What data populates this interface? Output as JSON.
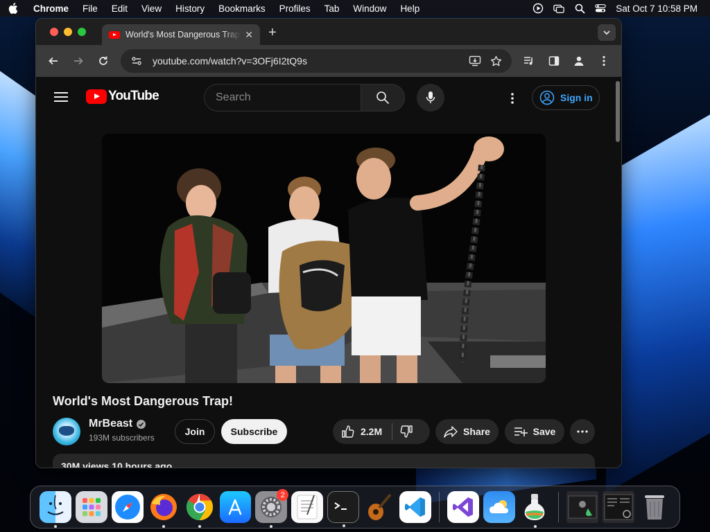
{
  "menubar": {
    "app_name": "Chrome",
    "items": [
      "File",
      "Edit",
      "View",
      "History",
      "Bookmarks",
      "Profiles",
      "Tab",
      "Window",
      "Help"
    ],
    "clock": "Sat Oct 7  10:58 PM"
  },
  "browser": {
    "tab_title": "World's Most Dangerous Trap!",
    "url": "youtube.com/watch?v=3OFj6I2tQ9s"
  },
  "youtube": {
    "logo_text": "YouTube",
    "search_placeholder": "Search",
    "sign_in_label": "Sign in",
    "video_title": "World's Most Dangerous Trap!",
    "channel_name": "MrBeast",
    "subscribers": "193M subscribers",
    "join_label": "Join",
    "subscribe_label": "Subscribe",
    "likes": "2.2M",
    "share_label": "Share",
    "save_label": "Save",
    "description_preview": "30M views  10 hours ago"
  },
  "dock": {
    "items": [
      "Finder",
      "Launchpad",
      "Safari",
      "Firefox",
      "Chrome",
      "App Store",
      "System Settings",
      "TextEdit",
      "Terminal",
      "GarageBand",
      "Visual Studio Code",
      "Visual Studio",
      "Weather",
      "Potion",
      "Recent Window 1",
      "Recent Window 2",
      "Trash"
    ],
    "settings_badge": "2"
  },
  "colors": {
    "youtube_red": "#ff0000",
    "link_blue": "#3ea6ff",
    "page_bg": "#0f0f0f"
  }
}
